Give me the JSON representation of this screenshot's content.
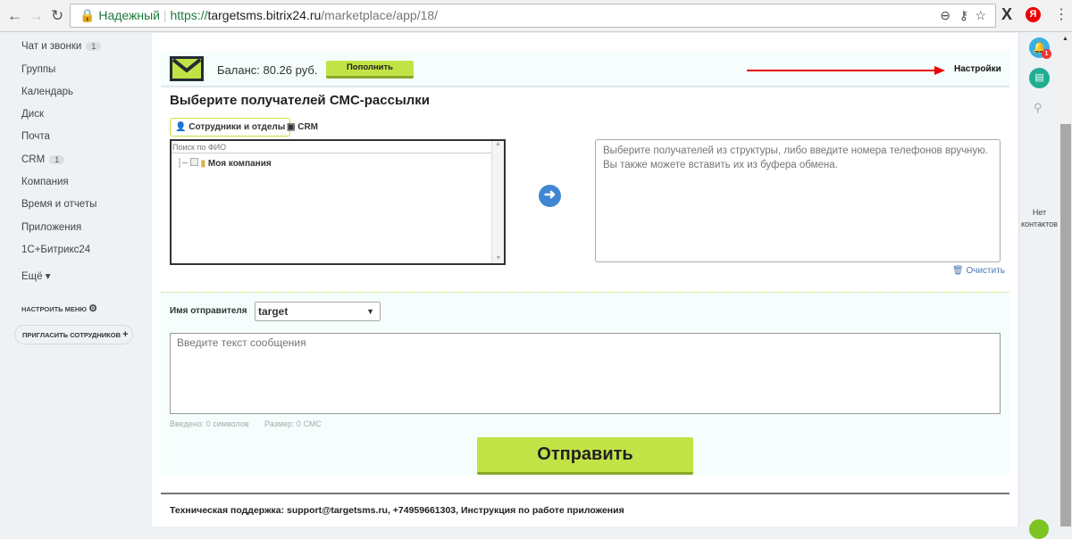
{
  "browser": {
    "secure_label": "Надежный",
    "url_scheme": "https://",
    "url_host": "targetsms.bitrix24.ru",
    "url_path": "/marketplace/app/18/"
  },
  "sidebar": {
    "items": [
      {
        "label": "Чат и звонки",
        "badge": "1"
      },
      {
        "label": "Группы"
      },
      {
        "label": "Календарь"
      },
      {
        "label": "Диск"
      },
      {
        "label": "Почта"
      },
      {
        "label": "CRM",
        "badge": "1"
      },
      {
        "label": "Компания"
      },
      {
        "label": "Время и отчеты"
      },
      {
        "label": "Приложения"
      },
      {
        "label": "1С+Битрикс24"
      },
      {
        "label": "Ещё ▾"
      }
    ],
    "configure_menu": "НАСТРОИТЬ МЕНЮ",
    "invite": "ПРИГЛАСИТЬ СОТРУДНИКОВ"
  },
  "header": {
    "balance": "Баланс: 80.26 руб.",
    "topup": "Пополнить",
    "settings": "Настройки"
  },
  "recipients": {
    "title": "Выберите получателей СМС-рассылки",
    "tabs": [
      "Сотрудники и отделы",
      "CRM"
    ],
    "search_placeholder": "Поиск по ФИО",
    "tree_root": "Моя компания",
    "phones_placeholder": "Выберите получателей из структуры, либо введите номера телефонов вручную. Вы также можете вставить их из буфера обмена.",
    "clear": "Очистить"
  },
  "message": {
    "sender_label": "Имя отправителя",
    "sender_value": "target",
    "text_placeholder": "Введите текст сообщения",
    "counter": "Введено: 0 символов",
    "size": "Размер: 0 СМС",
    "send": "Отправить"
  },
  "footer": {
    "text": "Техническая поддержка: support@targetsms.ru, +74959661303, Инструкция по работе приложения"
  },
  "right_panel": {
    "notif_count": "1",
    "no_contacts": "Нет контактов"
  }
}
